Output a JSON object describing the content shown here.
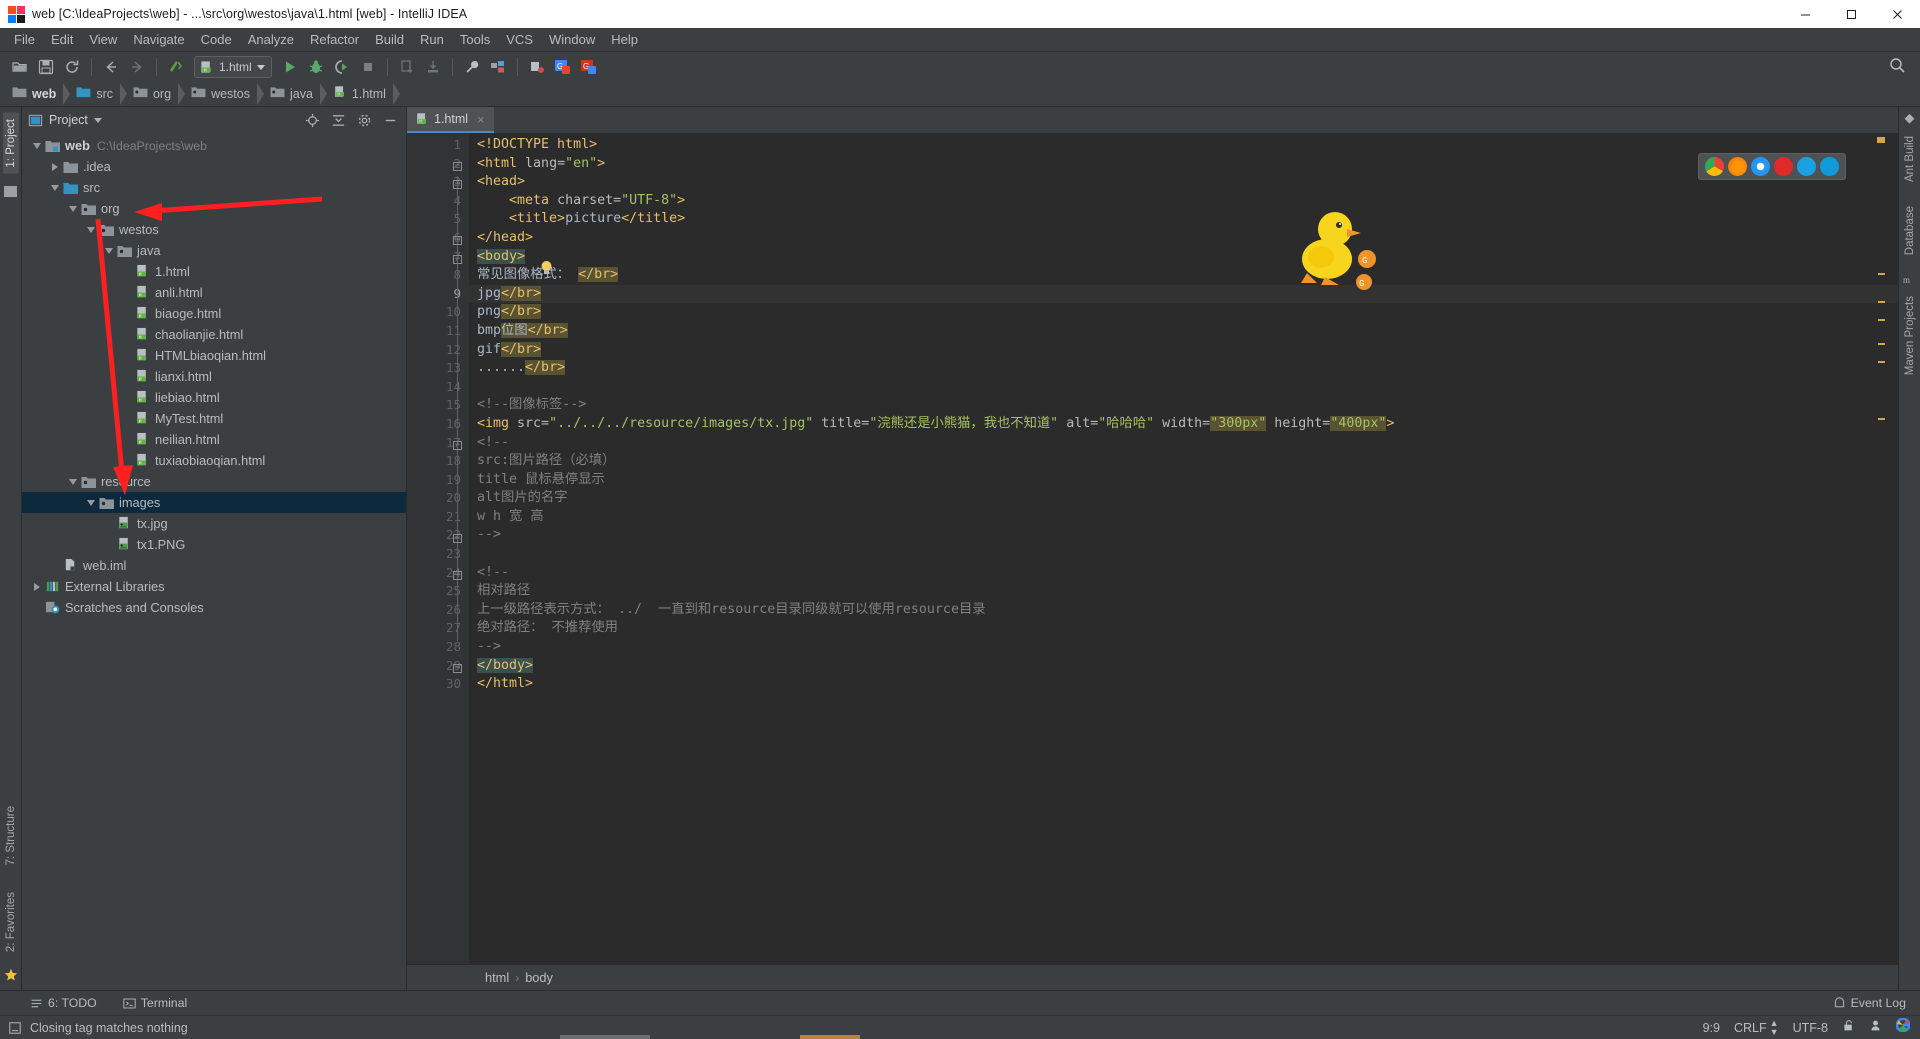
{
  "window": {
    "title": "web [C:\\IdeaProjects\\web] - ...\\src\\org\\westos\\java\\1.html [web] - IntelliJ IDEA",
    "minimize": "─",
    "maximize": "❑",
    "close": "✕"
  },
  "menu": [
    "File",
    "Edit",
    "View",
    "Navigate",
    "Code",
    "Analyze",
    "Refactor",
    "Build",
    "Run",
    "Tools",
    "VCS",
    "Window",
    "Help"
  ],
  "toolbar": {
    "run_config": "1.html",
    "icons": [
      "open-folder-icon",
      "save-all-icon",
      "sync-icon",
      "back-icon",
      "forward-icon",
      "compile-icon",
      "run-icon",
      "debug-icon",
      "run-coverage-icon",
      "stop-icon",
      "update-project-icon",
      "commit-icon",
      "settings-wrench-icon",
      "project-structure-icon",
      "toolbar-extra-icon",
      "translate-icon",
      "translate2-icon",
      "search-everywhere-icon"
    ]
  },
  "breadcrumbs": [
    {
      "label": "web",
      "icon": "module-folder-icon"
    },
    {
      "label": "src",
      "icon": "source-folder-icon"
    },
    {
      "label": "org",
      "icon": "package-folder-icon"
    },
    {
      "label": "westos",
      "icon": "package-folder-icon"
    },
    {
      "label": "java",
      "icon": "package-folder-icon"
    },
    {
      "label": "1.html",
      "icon": "html-file-icon"
    }
  ],
  "left_strip": {
    "tabs": [
      "1: Project",
      "7: Structure",
      "2: Favorites"
    ],
    "bottom_icon": "star-icon"
  },
  "right_strip": {
    "tabs": [
      "Ant Build",
      "Database",
      "Maven Projects"
    ]
  },
  "project_panel": {
    "title": "Project",
    "header_icons": [
      "locate-icon",
      "collapse-all-icon",
      "settings-gear-icon",
      "hide-icon"
    ],
    "tree": [
      {
        "label": "web",
        "path": "C:\\IdeaProjects\\web",
        "indent": 0,
        "toggle": "down",
        "icon": "module-icon",
        "bold": true,
        "selected": false
      },
      {
        "label": ".idea",
        "path": "",
        "indent": 1,
        "toggle": "right",
        "icon": "folder-icon",
        "bold": false,
        "selected": false
      },
      {
        "label": "src",
        "path": "",
        "indent": 1,
        "toggle": "down",
        "icon": "source-root-icon",
        "bold": false,
        "selected": false
      },
      {
        "label": "org",
        "path": "",
        "indent": 2,
        "toggle": "down",
        "icon": "package-icon",
        "bold": false,
        "selected": false
      },
      {
        "label": "westos",
        "path": "",
        "indent": 3,
        "toggle": "down",
        "icon": "package-icon",
        "bold": false,
        "selected": false
      },
      {
        "label": "java",
        "path": "",
        "indent": 4,
        "toggle": "down",
        "icon": "package-icon",
        "bold": false,
        "selected": false
      },
      {
        "label": "1.html",
        "path": "",
        "indent": 5,
        "toggle": "none",
        "icon": "html-file-icon",
        "bold": false,
        "selected": false
      },
      {
        "label": "anli.html",
        "path": "",
        "indent": 5,
        "toggle": "none",
        "icon": "html-file-icon",
        "bold": false,
        "selected": false
      },
      {
        "label": "biaoge.html",
        "path": "",
        "indent": 5,
        "toggle": "none",
        "icon": "html-file-icon",
        "bold": false,
        "selected": false
      },
      {
        "label": "chaolianjie.html",
        "path": "",
        "indent": 5,
        "toggle": "none",
        "icon": "html-file-icon",
        "bold": false,
        "selected": false
      },
      {
        "label": "HTMLbiaoqian.html",
        "path": "",
        "indent": 5,
        "toggle": "none",
        "icon": "html-file-icon",
        "bold": false,
        "selected": false
      },
      {
        "label": "lianxi.html",
        "path": "",
        "indent": 5,
        "toggle": "none",
        "icon": "html-file-icon",
        "bold": false,
        "selected": false
      },
      {
        "label": "liebiao.html",
        "path": "",
        "indent": 5,
        "toggle": "none",
        "icon": "html-file-icon",
        "bold": false,
        "selected": false
      },
      {
        "label": "MyTest.html",
        "path": "",
        "indent": 5,
        "toggle": "none",
        "icon": "html-file-icon",
        "bold": false,
        "selected": false
      },
      {
        "label": "neilian.html",
        "path": "",
        "indent": 5,
        "toggle": "none",
        "icon": "html-file-icon",
        "bold": false,
        "selected": false
      },
      {
        "label": "tuxiaobiaoqian.html",
        "path": "",
        "indent": 5,
        "toggle": "none",
        "icon": "html-file-icon",
        "bold": false,
        "selected": false
      },
      {
        "label": "resource",
        "path": "",
        "indent": 2,
        "toggle": "down",
        "icon": "package-icon",
        "bold": false,
        "selected": false
      },
      {
        "label": "images",
        "path": "",
        "indent": 3,
        "toggle": "down",
        "icon": "package-icon",
        "bold": false,
        "selected": true
      },
      {
        "label": "tx.jpg",
        "path": "",
        "indent": 4,
        "toggle": "none",
        "icon": "image-file-icon",
        "bold": false,
        "selected": false
      },
      {
        "label": "tx1.PNG",
        "path": "",
        "indent": 4,
        "toggle": "none",
        "icon": "image-file-icon",
        "bold": false,
        "selected": false
      },
      {
        "label": "web.iml",
        "path": "",
        "indent": 1,
        "toggle": "none",
        "icon": "iml-file-icon",
        "bold": false,
        "selected": false
      },
      {
        "label": "External Libraries",
        "path": "",
        "indent": 0,
        "toggle": "right",
        "icon": "libraries-icon",
        "bold": false,
        "selected": false
      },
      {
        "label": "Scratches and Consoles",
        "path": "",
        "indent": 0,
        "toggle": "none",
        "icon": "scratches-icon",
        "bold": false,
        "selected": false
      }
    ]
  },
  "editor": {
    "tab": {
      "label": "1.html",
      "icon": "html-file-icon",
      "close": "×"
    },
    "breadcrumb": [
      "html",
      "body"
    ],
    "breadcrumb_separator": "›",
    "current_line": 9,
    "line_count": 30,
    "browser_icons": [
      "chrome-icon",
      "firefox-icon",
      "safari-icon",
      "opera-icon",
      "ie-icon",
      "edge-icon"
    ],
    "lines": [
      {
        "n": 1,
        "segments": [
          {
            "t": "<!DOCTYPE html>",
            "c": "tag"
          }
        ]
      },
      {
        "n": 2,
        "segments": [
          {
            "t": "<html ",
            "c": "tag"
          },
          {
            "t": "lang=",
            "c": "attr"
          },
          {
            "t": "\"en\"",
            "c": "str"
          },
          {
            "t": ">",
            "c": "tag"
          }
        ]
      },
      {
        "n": 3,
        "segments": [
          {
            "t": "<head>",
            "c": "tag"
          }
        ]
      },
      {
        "n": 4,
        "segments": [
          {
            "t": "    <meta ",
            "c": "tag"
          },
          {
            "t": "charset=",
            "c": "attr"
          },
          {
            "t": "\"UTF-8\"",
            "c": "str"
          },
          {
            "t": ">",
            "c": "tag"
          }
        ]
      },
      {
        "n": 5,
        "segments": [
          {
            "t": "    <title>",
            "c": "tag"
          },
          {
            "t": "picture",
            "c": "txt"
          },
          {
            "t": "</title>",
            "c": "tag"
          }
        ]
      },
      {
        "n": 6,
        "segments": [
          {
            "t": "</head>",
            "c": "tag"
          }
        ]
      },
      {
        "n": 7,
        "segments": [
          {
            "t": "<body>",
            "c": "tag sel-body"
          }
        ]
      },
      {
        "n": 8,
        "segments": [
          {
            "t": "常见图像格式： ",
            "c": "txt"
          },
          {
            "t": "</br>",
            "c": "tag sel-br"
          }
        ]
      },
      {
        "n": 9,
        "segments": [
          {
            "t": "jpg",
            "c": "txt"
          },
          {
            "t": "</br>",
            "c": "tag sel-br"
          }
        ]
      },
      {
        "n": 10,
        "segments": [
          {
            "t": "png",
            "c": "txt"
          },
          {
            "t": "</br>",
            "c": "tag sel-br"
          }
        ]
      },
      {
        "n": 11,
        "segments": [
          {
            "t": "bmp",
            "c": "txt"
          },
          {
            "t": "位图",
            "c": "txt sel-br"
          },
          {
            "t": "</br>",
            "c": "tag sel-br"
          }
        ]
      },
      {
        "n": 12,
        "segments": [
          {
            "t": "gif",
            "c": "txt"
          },
          {
            "t": "</br>",
            "c": "tag sel-br"
          }
        ]
      },
      {
        "n": 13,
        "segments": [
          {
            "t": "......",
            "c": "txt"
          },
          {
            "t": "</br>",
            "c": "tag sel-br"
          }
        ]
      },
      {
        "n": 14,
        "segments": [
          {
            "t": "",
            "c": "txt"
          }
        ]
      },
      {
        "n": 15,
        "segments": [
          {
            "t": "<!--图像标签-->",
            "c": "cmt"
          }
        ]
      },
      {
        "n": 16,
        "segments": [
          {
            "t": "<img ",
            "c": "tag"
          },
          {
            "t": "src=",
            "c": "attr"
          },
          {
            "t": "\"../../../resource/images/tx.jpg\"",
            "c": "str"
          },
          {
            "t": " ",
            "c": "txt"
          },
          {
            "t": "title=",
            "c": "attr"
          },
          {
            "t": "\"浣熊还是小熊猫，我也不知道\"",
            "c": "str"
          },
          {
            "t": " ",
            "c": "txt"
          },
          {
            "t": "alt=",
            "c": "attr"
          },
          {
            "t": "\"哈哈哈\"",
            "c": "str"
          },
          {
            "t": " ",
            "c": "txt"
          },
          {
            "t": "width=",
            "c": "attr"
          },
          {
            "t": "\"300px\"",
            "c": "str sel-br"
          },
          {
            "t": " ",
            "c": "txt"
          },
          {
            "t": "height=",
            "c": "attr"
          },
          {
            "t": "\"400px\"",
            "c": "str sel-br"
          },
          {
            "t": ">",
            "c": "tag"
          }
        ]
      },
      {
        "n": 17,
        "segments": [
          {
            "t": "<!--",
            "c": "cmt"
          }
        ]
      },
      {
        "n": 18,
        "segments": [
          {
            "t": "src:图片路径（必填）",
            "c": "cmt"
          }
        ]
      },
      {
        "n": 19,
        "segments": [
          {
            "t": "title 鼠标悬停显示",
            "c": "cmt"
          }
        ]
      },
      {
        "n": 20,
        "segments": [
          {
            "t": "alt图片的名字",
            "c": "cmt"
          }
        ]
      },
      {
        "n": 21,
        "segments": [
          {
            "t": "w h 宽 高",
            "c": "cmt"
          }
        ]
      },
      {
        "n": 22,
        "segments": [
          {
            "t": "-->",
            "c": "cmt"
          }
        ]
      },
      {
        "n": 23,
        "segments": [
          {
            "t": "",
            "c": "txt"
          }
        ]
      },
      {
        "n": 24,
        "segments": [
          {
            "t": "<!--",
            "c": "cmt"
          }
        ]
      },
      {
        "n": 25,
        "segments": [
          {
            "t": "相对路径",
            "c": "cmt"
          }
        ]
      },
      {
        "n": 26,
        "segments": [
          {
            "t": "上一级路径表示方式： ../  一直到和resource目录同级就可以使用resource目录",
            "c": "cmt"
          }
        ]
      },
      {
        "n": 27,
        "segments": [
          {
            "t": "绝对路径： 不推荐使用",
            "c": "cmt"
          }
        ]
      },
      {
        "n": 28,
        "segments": [
          {
            "t": "-->",
            "c": "cmt"
          }
        ]
      },
      {
        "n": 29,
        "segments": [
          {
            "t": "</body>",
            "c": "tag sel-body"
          }
        ]
      },
      {
        "n": 30,
        "segments": [
          {
            "t": "</html>",
            "c": "tag"
          }
        ]
      }
    ]
  },
  "tool_window_bar": {
    "todo": "6: TODO",
    "terminal": "Terminal",
    "event_log": "Event Log"
  },
  "status_bar": {
    "message": "Closing tag matches nothing",
    "caret": "9:9",
    "line_separator": "CRLF",
    "encoding": "UTF-8",
    "icons": [
      "lock-open-icon",
      "inspector-icon",
      "google-icon"
    ]
  },
  "colors": {
    "accent_blue": "#4a88c7",
    "selection_blue": "#0d293e",
    "annotation_red": "#fe2020",
    "tag_orange": "#e8bf6a",
    "string_green": "#a5c261",
    "comment_gray": "#808080"
  }
}
